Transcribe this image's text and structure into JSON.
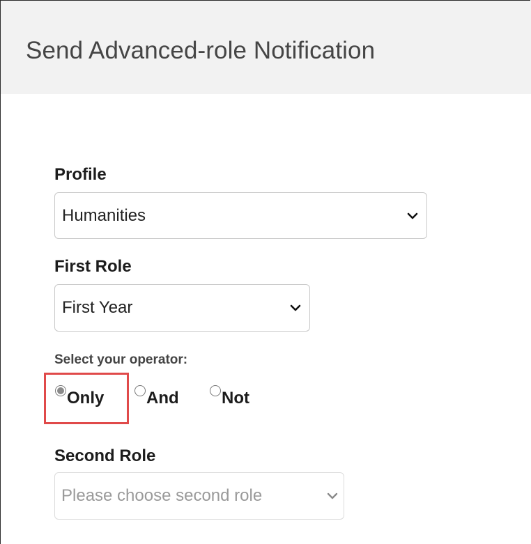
{
  "header": {
    "title": "Send Advanced-role Notification"
  },
  "form": {
    "profile": {
      "label": "Profile",
      "selected": "Humanities"
    },
    "first_role": {
      "label": "First Role",
      "selected": "First Year"
    },
    "operator": {
      "label": "Select your operator:",
      "options": [
        {
          "label": "Only",
          "checked": true
        },
        {
          "label": "And",
          "checked": false
        },
        {
          "label": "Not",
          "checked": false
        }
      ]
    },
    "second_role": {
      "label": "Second Role",
      "placeholder": "Please choose second role",
      "disabled": true
    }
  },
  "colors": {
    "highlight": "#e04a4a",
    "header_bg": "#f2f2f2"
  },
  "icons": {
    "select_arrow": "chevron-down-icon"
  }
}
